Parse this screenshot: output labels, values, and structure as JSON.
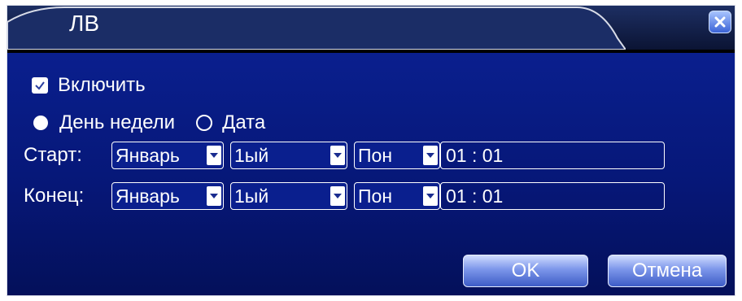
{
  "dialog": {
    "title": "ЛВ",
    "close_icon": "close-icon"
  },
  "enable": {
    "label": "Включить",
    "checked": true
  },
  "mode": {
    "options": [
      "День недели",
      "Дата"
    ],
    "selected": "День недели"
  },
  "start": {
    "label": "Старт:",
    "month": "Январь",
    "week": "1ый",
    "day": "Пон",
    "time": "01 : 01"
  },
  "end": {
    "label": "Конец:",
    "month": "Январь",
    "week": "1ый",
    "day": "Пон",
    "time": "01 : 01"
  },
  "buttons": {
    "ok": "OK",
    "cancel": "Отмена"
  },
  "colors": {
    "panel": "#0a1f8e",
    "titlebar": "#1d2f63",
    "button": "#5e7de0"
  }
}
